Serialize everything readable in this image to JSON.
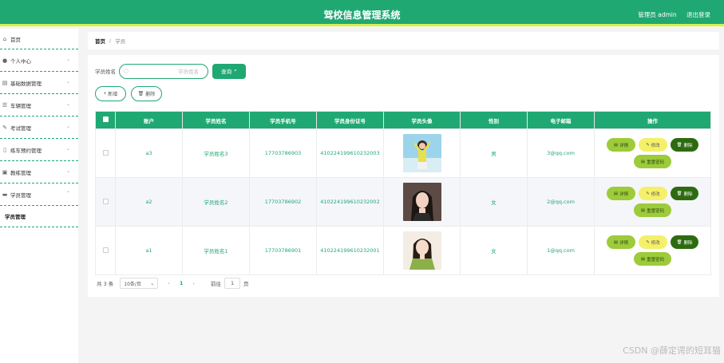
{
  "header": {
    "title": "驾校信息管理系统",
    "user": "管理员 admin",
    "logout": "退出登录"
  },
  "sidebar": {
    "home": "首页",
    "items": [
      {
        "label": "个人中心",
        "icon": "user-icon"
      },
      {
        "label": "基础数据管理",
        "icon": "database-icon"
      },
      {
        "label": "车辆管理",
        "icon": "sliders-icon"
      },
      {
        "label": "考试管理",
        "icon": "exam-icon"
      },
      {
        "label": "练车预约管理",
        "icon": "phone-icon"
      },
      {
        "label": "教练管理",
        "icon": "image-icon"
      },
      {
        "label": "学员管理",
        "icon": "chat-icon"
      }
    ],
    "sub_item": "学员管理"
  },
  "breadcrumb": {
    "home": "首页",
    "separator": "/",
    "current": "学员"
  },
  "search": {
    "label": "学员姓名",
    "placeholder": "学员姓名",
    "button": "查询"
  },
  "actions": {
    "add": "新增",
    "delete": "删除"
  },
  "table": {
    "headers": [
      "",
      "账户",
      "学员姓名",
      "学员手机号",
      "学员身份证号",
      "学员头像",
      "性别",
      "电子邮箱",
      "操作"
    ],
    "rows": [
      {
        "account": "a3",
        "name": "学员姓名3",
        "phone": "17703786903",
        "id_card": "410224199610232003",
        "gender": "男",
        "email": "3@qq.com"
      },
      {
        "account": "a2",
        "name": "学员姓名2",
        "phone": "17703786902",
        "id_card": "410224199610232002",
        "gender": "女",
        "email": "2@qq.com"
      },
      {
        "account": "a1",
        "name": "学员姓名1",
        "phone": "17703786901",
        "id_card": "410224199610232001",
        "gender": "女",
        "email": "1@qq.com"
      }
    ],
    "ops": {
      "detail": "详情",
      "edit": "修改",
      "delete": "删除",
      "reset": "重置密码"
    }
  },
  "pager": {
    "total": "共 3 条",
    "page_size": "10条/页",
    "prev": "‹",
    "current": "1",
    "next": "›",
    "goto": "前往",
    "page_input": "1",
    "page_unit": "页"
  },
  "watermark": "CSDN @薛定谔的短耳猫",
  "colors": {
    "primary": "#20a872",
    "accent_bar": "#d8f04a",
    "detail_btn": "#9dcb3a",
    "edit_btn": "#f5f06a",
    "delete_btn": "#2e6b10"
  }
}
